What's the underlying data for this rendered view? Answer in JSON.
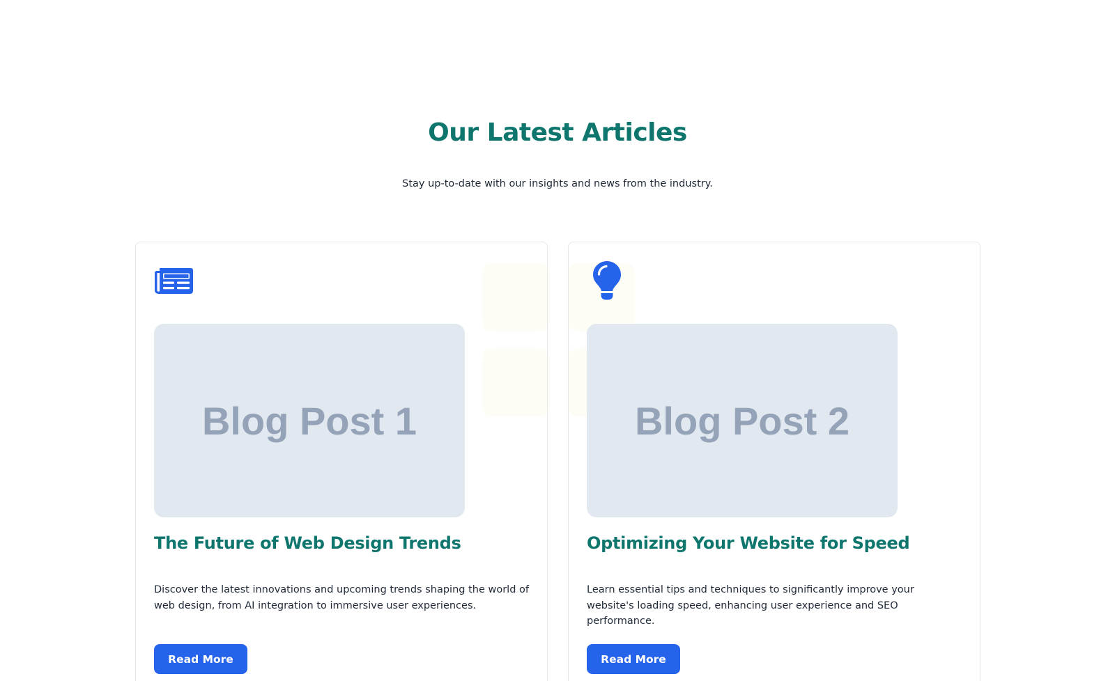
{
  "section": {
    "title": "Our Latest Articles",
    "subtitle": "Stay up-to-date with our insights and news from the industry."
  },
  "articles": [
    {
      "icon": "newspaper-icon",
      "image_label": "Blog Post 1",
      "title": "The Future of Web Design Trends",
      "description": "Discover the latest innovations and upcoming trends shaping the world of web design, from AI integration to immersive user experiences.",
      "button_label": "Read More"
    },
    {
      "icon": "lightbulb-icon",
      "image_label": "Blog Post 2",
      "title": "Optimizing Your Website for Speed",
      "description": "Learn essential tips and techniques to significantly improve your website's loading speed, enhancing user experience and SEO performance.",
      "button_label": "Read More"
    }
  ],
  "colors": {
    "heading": "#0f766e",
    "accent": "#2563eb",
    "image_placeholder": "#e2e8f0",
    "image_placeholder_text": "#94a3b8"
  }
}
